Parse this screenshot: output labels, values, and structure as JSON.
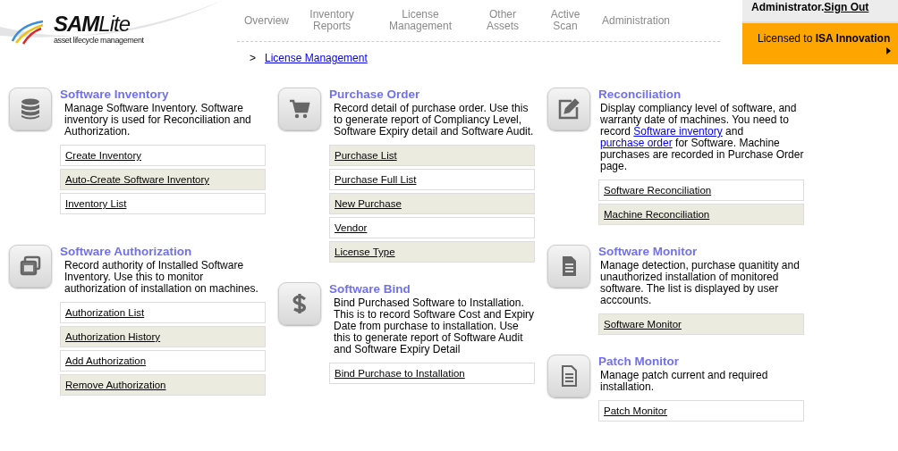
{
  "logo": {
    "brand_bold": "SAM",
    "brand_light": "Lite",
    "tagline": "asset lifecycle management"
  },
  "nav": [
    {
      "label": "Overview"
    },
    {
      "label": "Inventory Reports"
    },
    {
      "label": "License Management"
    },
    {
      "label": "Other Assets"
    },
    {
      "label": "Active Scan"
    },
    {
      "label": "Administration"
    }
  ],
  "breadcrumb": {
    "separator": ">",
    "link": "License Management"
  },
  "account": {
    "user": "Administrator.",
    "sign_out": "Sign Out",
    "license_prefix": "Licensed to",
    "license_holder": "ISA Innovation"
  },
  "columns": [
    {
      "sections": [
        {
          "kind": "database",
          "title": "Software Inventory",
          "description": [
            {
              "kind": "text",
              "text": "Manage Software Inventory. Software inventory is used for Reconciliation and Authorization."
            }
          ],
          "links": [
            {
              "label": "Create Inventory",
              "shaded": false
            },
            {
              "label": "Auto-Create Software Inventory",
              "shaded": true
            },
            {
              "label": "Inventory List",
              "shaded": false
            }
          ]
        },
        {
          "kind": "windows",
          "title": "Software Authorization",
          "description": [
            {
              "kind": "text",
              "text": "Record authority of Installed Software Inventory. Use this to monitor authorization of installation on machines."
            }
          ],
          "links": [
            {
              "label": "Authorization List",
              "shaded": false
            },
            {
              "label": "Authorization History",
              "shaded": true
            },
            {
              "label": "Add Authorization",
              "shaded": false
            },
            {
              "label": "Remove Authorization",
              "shaded": true
            }
          ]
        }
      ]
    },
    {
      "sections": [
        {
          "kind": "cart",
          "title": "Purchase Order",
          "description": [
            {
              "kind": "text",
              "text": "Record detail of purchase order. Use this to generate report of Compliancy Level, Software Expiry detail and Software Audit."
            }
          ],
          "links": [
            {
              "label": "Purchase List",
              "shaded": true
            },
            {
              "label": "Purchase Full List",
              "shaded": false
            },
            {
              "label": "New Purchase",
              "shaded": true
            },
            {
              "label": "Vendor",
              "shaded": false
            },
            {
              "label": "License Type",
              "shaded": true
            }
          ]
        },
        {
          "kind": "dollar",
          "title": "Software Bind",
          "description": [
            {
              "kind": "text",
              "text": "Bind Purchased Software to Installation. This is to record Software Cost and Expiry Date from purchase to installation. Use this to generate report of Software Audit and Software Expiry Detail"
            }
          ],
          "links": [
            {
              "label": "Bind Purchase to Installation",
              "shaded": false
            }
          ]
        }
      ]
    },
    {
      "sections": [
        {
          "kind": "edit",
          "title": "Reconciliation",
          "description": [
            {
              "kind": "text",
              "text": "Display compliancy level of software, and warranty date of machines. You need to record "
            },
            {
              "kind": "link",
              "text": "Software inventory"
            },
            {
              "kind": "text",
              "text": " and "
            },
            {
              "kind": "link",
              "text": "purchase order"
            },
            {
              "kind": "text",
              "text": " for Software. Machine purchases are recorded in Purchase Order page."
            }
          ],
          "links": [
            {
              "label": "Software Reconciliation",
              "shaded": false
            },
            {
              "label": "Machine Reconciliation",
              "shaded": true
            }
          ]
        },
        {
          "kind": "document",
          "title": "Software Monitor",
          "description": [
            {
              "kind": "text",
              "text": "Manage detection, purchase quanitity and unauthorized installation of monitored software. The list is displayed by user acccounts."
            }
          ],
          "links": [
            {
              "label": "Software Monitor",
              "shaded": true
            }
          ]
        },
        {
          "kind": "page",
          "title": "Patch Monitor",
          "description": [
            {
              "kind": "text",
              "text": "Manage patch current and required installation."
            }
          ],
          "links": [
            {
              "label": "Patch Monitor",
              "shaded": false
            }
          ]
        }
      ]
    }
  ]
}
